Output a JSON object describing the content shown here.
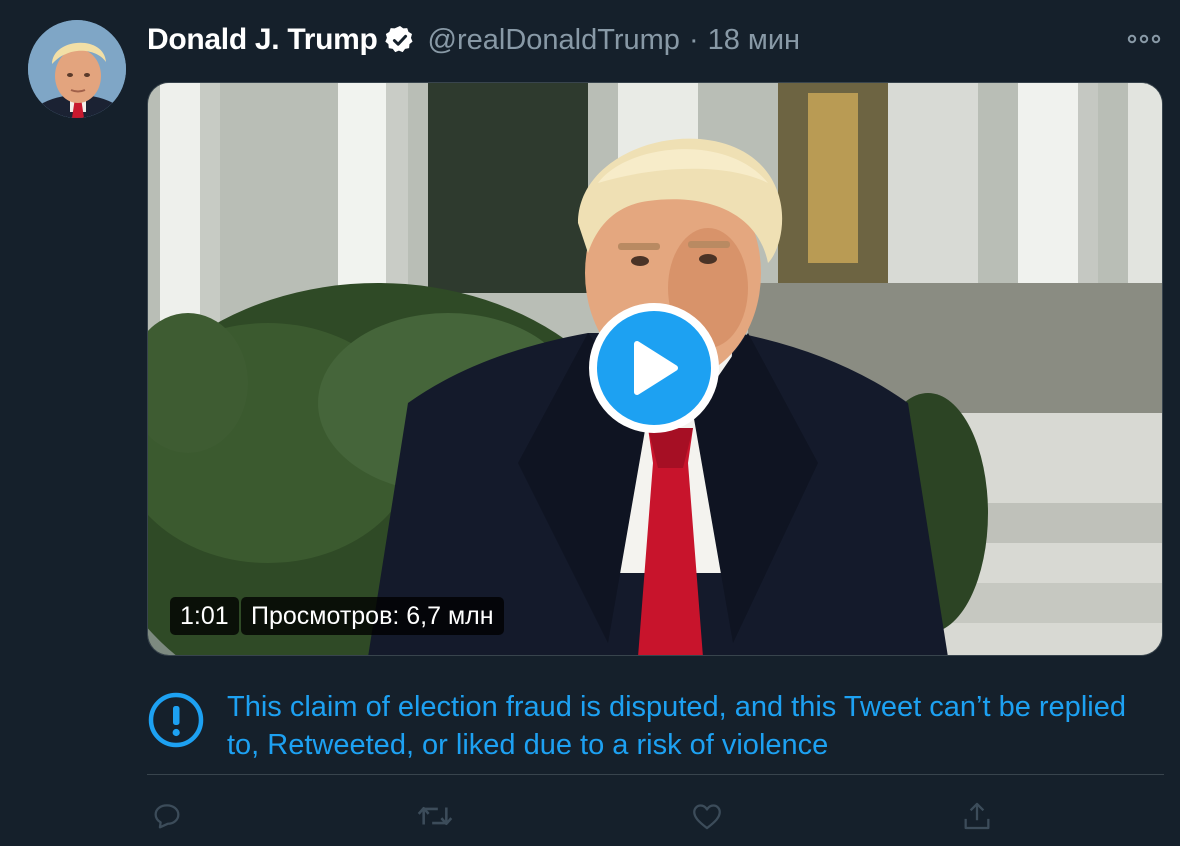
{
  "tweet": {
    "author": {
      "display_name": "Donald J. Trump",
      "handle": "@realDonaldTrump",
      "verified": true
    },
    "separator": "·",
    "time_ago": "18 мин",
    "media": {
      "type": "video",
      "duration": "1:01",
      "views": "Просмотров: 6,7 млн"
    },
    "notice": {
      "text": "This claim of election fraud is disputed, and this Tweet can’t be replied to, Retweeted, or liked due to a risk of violence",
      "color": "#1da1f2"
    },
    "actions": [
      "reply-icon",
      "retweet-icon",
      "like-icon",
      "share-icon"
    ]
  },
  "colors": {
    "background": "#15202b",
    "accent": "#1da1f2",
    "muted": "#8899a6",
    "border": "#38444d"
  }
}
